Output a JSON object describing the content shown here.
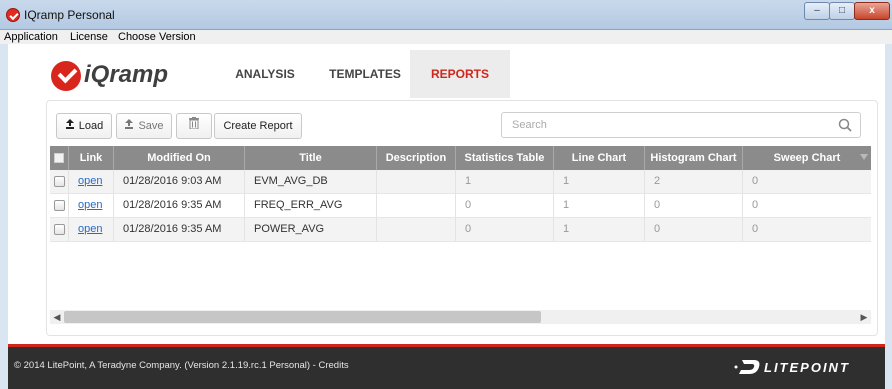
{
  "window": {
    "title": "IQramp Personal",
    "controls": {
      "minimize": "–",
      "maximize": "□",
      "close": "x"
    }
  },
  "menu": [
    "Application",
    "License",
    "Choose Version"
  ],
  "brand": {
    "logo_text": "iQramp"
  },
  "nav": {
    "tabs": [
      "ANALYSIS",
      "TEMPLATES",
      "REPORTS"
    ],
    "active": "REPORTS"
  },
  "toolbar": {
    "load_label": "Load",
    "save_label": "Save",
    "create_label": "Create Report",
    "search_placeholder": "Search"
  },
  "table": {
    "columns": [
      "",
      "Link",
      "Modified On",
      "Title",
      "Description",
      "Statistics Table",
      "Line Chart",
      "Histogram Chart",
      "Sweep Chart"
    ],
    "rows": [
      {
        "link": "open",
        "modified": "01/28/2016 9:03 AM",
        "title": "EVM_AVG_DB",
        "description": "",
        "statistics": "1",
        "line": "1",
        "histogram": "2",
        "sweep": "0"
      },
      {
        "link": "open",
        "modified": "01/28/2016 9:35 AM",
        "title": "FREQ_ERR_AVG",
        "description": "",
        "statistics": "0",
        "line": "1",
        "histogram": "0",
        "sweep": "0"
      },
      {
        "link": "open",
        "modified": "01/28/2016 9:35 AM",
        "title": "POWER_AVG",
        "description": "",
        "statistics": "0",
        "line": "1",
        "histogram": "0",
        "sweep": "0"
      }
    ]
  },
  "footer": {
    "copyright": "© 2014 LitePoint, A Teradyne Company. (Version 2.1.19.rc.1 Personal) - Credits",
    "brand": "LITEPOINT"
  },
  "colors": {
    "accent": "#d0271d",
    "header_bg": "#8b8b8b",
    "footer_bg": "#2f2f2f",
    "link": "#2a6ac6"
  }
}
